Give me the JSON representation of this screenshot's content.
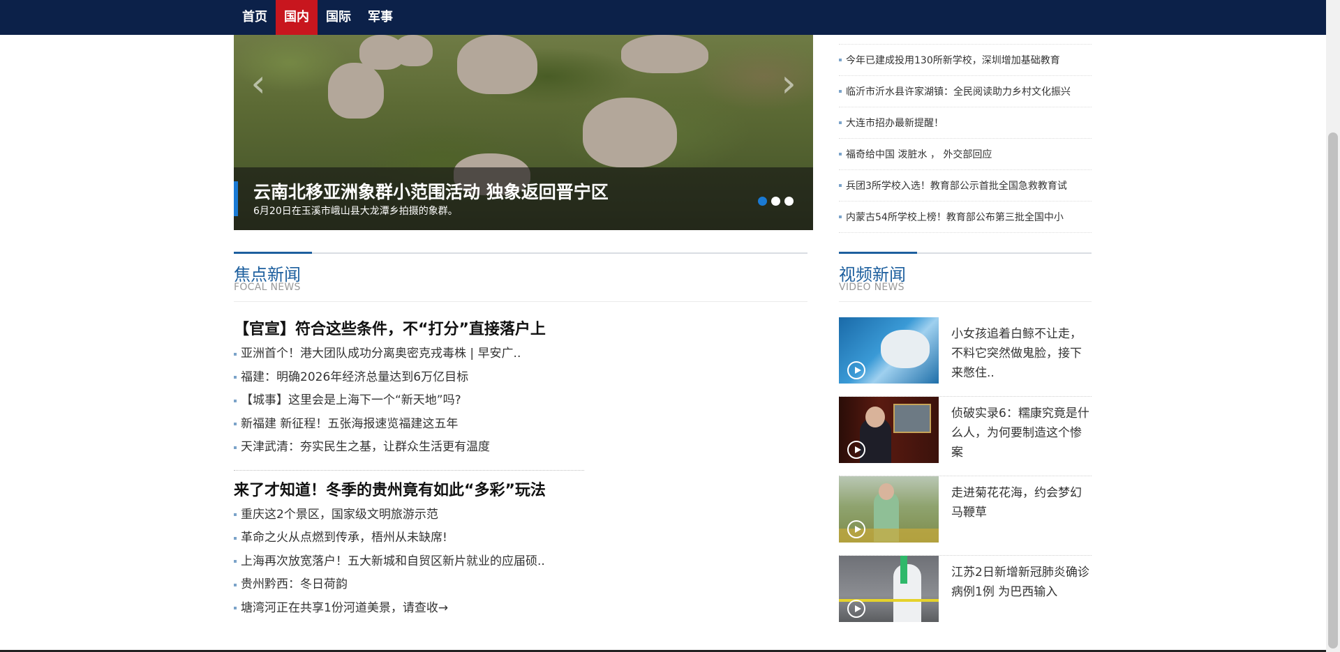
{
  "nav": {
    "items": [
      {
        "label": "首页",
        "active": false
      },
      {
        "label": "国内",
        "active": true
      },
      {
        "label": "国际",
        "active": false
      },
      {
        "label": "军事",
        "active": false
      }
    ],
    "colors": {
      "bar": "#0c2149",
      "active": "#c8161e"
    }
  },
  "slider": {
    "title": "云南北移亚洲象群小范围活动 独象返回晋宁区",
    "subtitle": "6月20日在玉溪市峨山县大龙潭乡拍摄的象群。",
    "prev_icon": "chevron-left-icon",
    "next_icon": "chevron-right-icon",
    "dots": 3,
    "active_dot": 1
  },
  "top_list": [
    "今年已建成投用130所新学校，深圳增加基础教育",
    "临沂市沂水县许家湖镇：全民阅读助力乡村文化振兴",
    "大连市招办最新提醒！",
    "福奇给中国 泼脏水 ， 外交部回应",
    "兵团3所学校入选！教育部公示首批全国急救教育试",
    "内蒙古54所学校上榜！教育部公布第三批全国中小"
  ],
  "focal": {
    "heading": "焦点新闻",
    "heading_en": "FOCAL NEWS",
    "groups": [
      {
        "headline": "【官宣】符合这些条件，不“打分”直接落户上",
        "items": [
          "亚洲首个！港大团队成功分离奥密克戎毒株 | 早安广..",
          "福建：明确2026年经济总量达到6万亿目标",
          "【城事】这里会是上海下一个“新天地”吗?",
          "新福建 新征程！五张海报速览福建这五年",
          "天津武清：夯实民生之基，让群众生活更有温度"
        ]
      },
      {
        "headline": "来了才知道！冬季的贵州竟有如此“多彩”玩法",
        "items": [
          "重庆这2个景区，国家级文明旅游示范",
          "革命之火从点燃到传承，梧州从未缺席!",
          "上海再次放宽落户！五大新城和自贸区新片就业的应届硕..",
          "贵州黔西：冬日荷韵",
          "塘湾河正在共享1份河道美景，请查收→"
        ]
      }
    ]
  },
  "video": {
    "heading": "视频新闻",
    "heading_en": "VIDEO NEWS",
    "items": [
      {
        "text": "小女孩追着白鲸不让走，不料它突然做鬼脸，接下来憋住.."
      },
      {
        "text": "侦破实录6：糯康究竟是什么人，为何要制造这个惨案"
      },
      {
        "text": "走进菊花花海，约会梦幻马鞭草"
      },
      {
        "text": "江苏2日新增新冠肺炎确诊病例1例 为巴西输入"
      }
    ]
  }
}
